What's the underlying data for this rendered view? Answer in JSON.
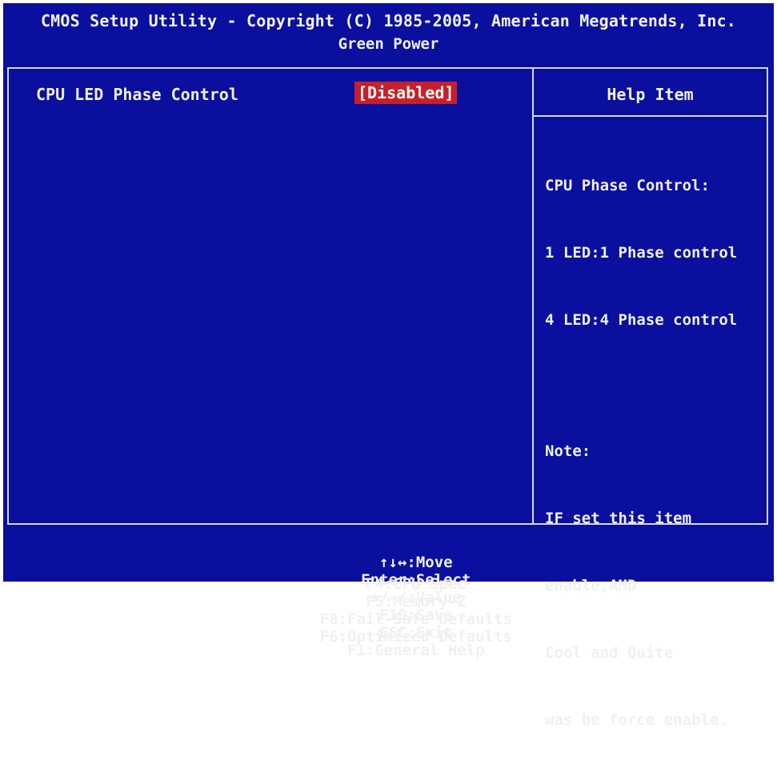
{
  "header": {
    "title": "CMOS Setup Utility - Copyright (C) 1985-2005, American Megatrends, Inc.",
    "subtitle": "Green Power"
  },
  "settings": [
    {
      "label": "CPU LED Phase Control",
      "value": "[Disabled]"
    }
  ],
  "help": {
    "title": "Help Item",
    "lines1": [
      "CPU Phase Control:",
      "1 LED:1 Phase control",
      "4 LED:4 Phase control"
    ],
    "lines2": [
      "Note:",
      "IF set this item",
      "enable,AMD",
      "Cool and Quite",
      "was be force enable."
    ]
  },
  "footer": {
    "row1": [
      "↑↓↔:Move",
      "Enter:Select",
      "+/-/:Value",
      "F10:Save",
      "ESC:Exit",
      "F1:General Help"
    ],
    "row2": [
      "F4:CPU Spec",
      "F5:Memory-Z",
      "F8:Fail-Safe Defaults",
      "F6:Optimized Defaults"
    ]
  },
  "colors": {
    "background": "#0a0f9e",
    "highlight": "#c8202a",
    "text": "#f0f0f0"
  }
}
